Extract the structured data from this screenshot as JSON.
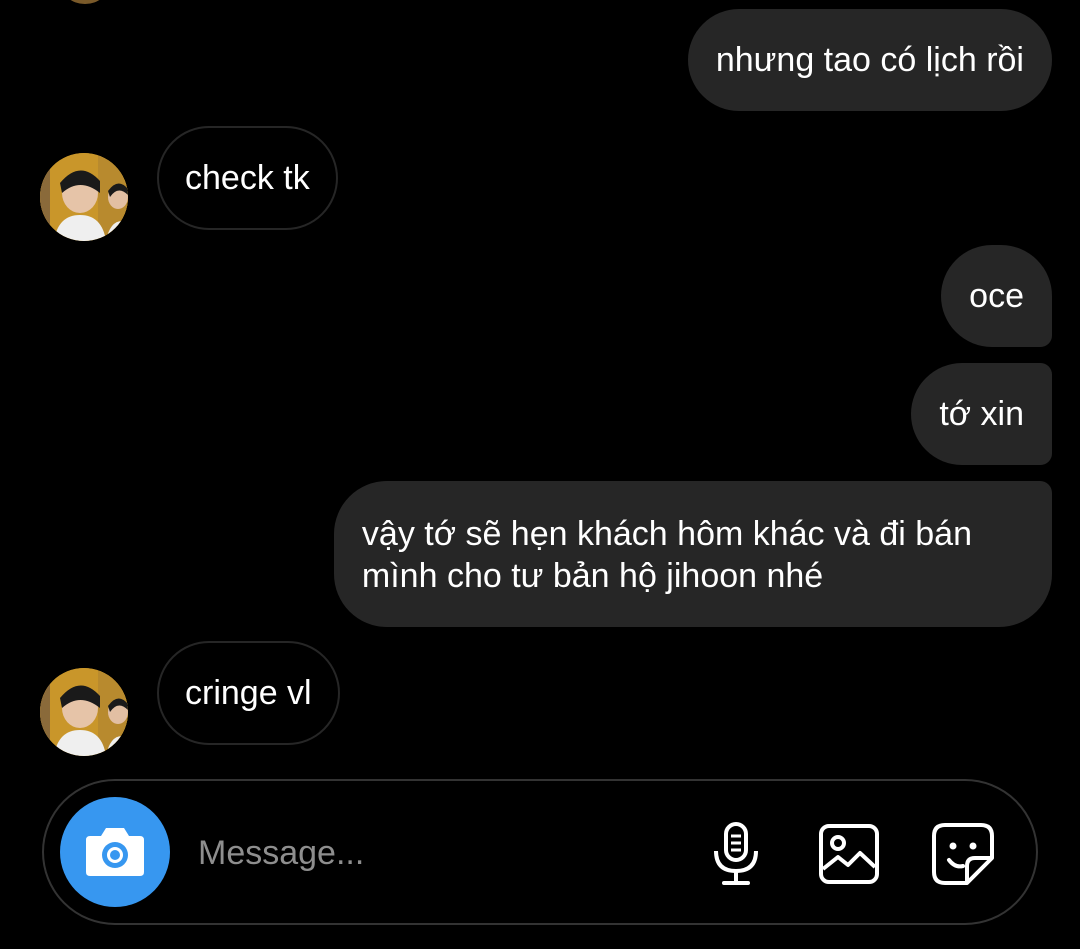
{
  "colors": {
    "background": "#000000",
    "sent_bubble": "#262626",
    "received_border": "#262626",
    "camera_button": "#3797f0",
    "placeholder": "#8e8e8e"
  },
  "messages": [
    {
      "direction": "sent",
      "text": "nhưng tao có lịch rồi"
    },
    {
      "direction": "received",
      "text": "check tk",
      "avatar": "profile-avatar"
    },
    {
      "direction": "sent",
      "text": "oce"
    },
    {
      "direction": "sent",
      "text": "tớ xin"
    },
    {
      "direction": "sent",
      "lines": [
        "vậy tớ sẽ hẹn khách hôm khác và đi bán",
        "mình cho tư bản hộ jihoon nhé"
      ]
    },
    {
      "direction": "received",
      "text": "cringe vl",
      "avatar": "profile-avatar"
    }
  ],
  "composer": {
    "placeholder": "Message...",
    "camera_icon": "camera-icon",
    "microphone_icon": "microphone-icon",
    "gallery_icon": "image-gallery-icon",
    "sticker_icon": "sticker-icon"
  }
}
